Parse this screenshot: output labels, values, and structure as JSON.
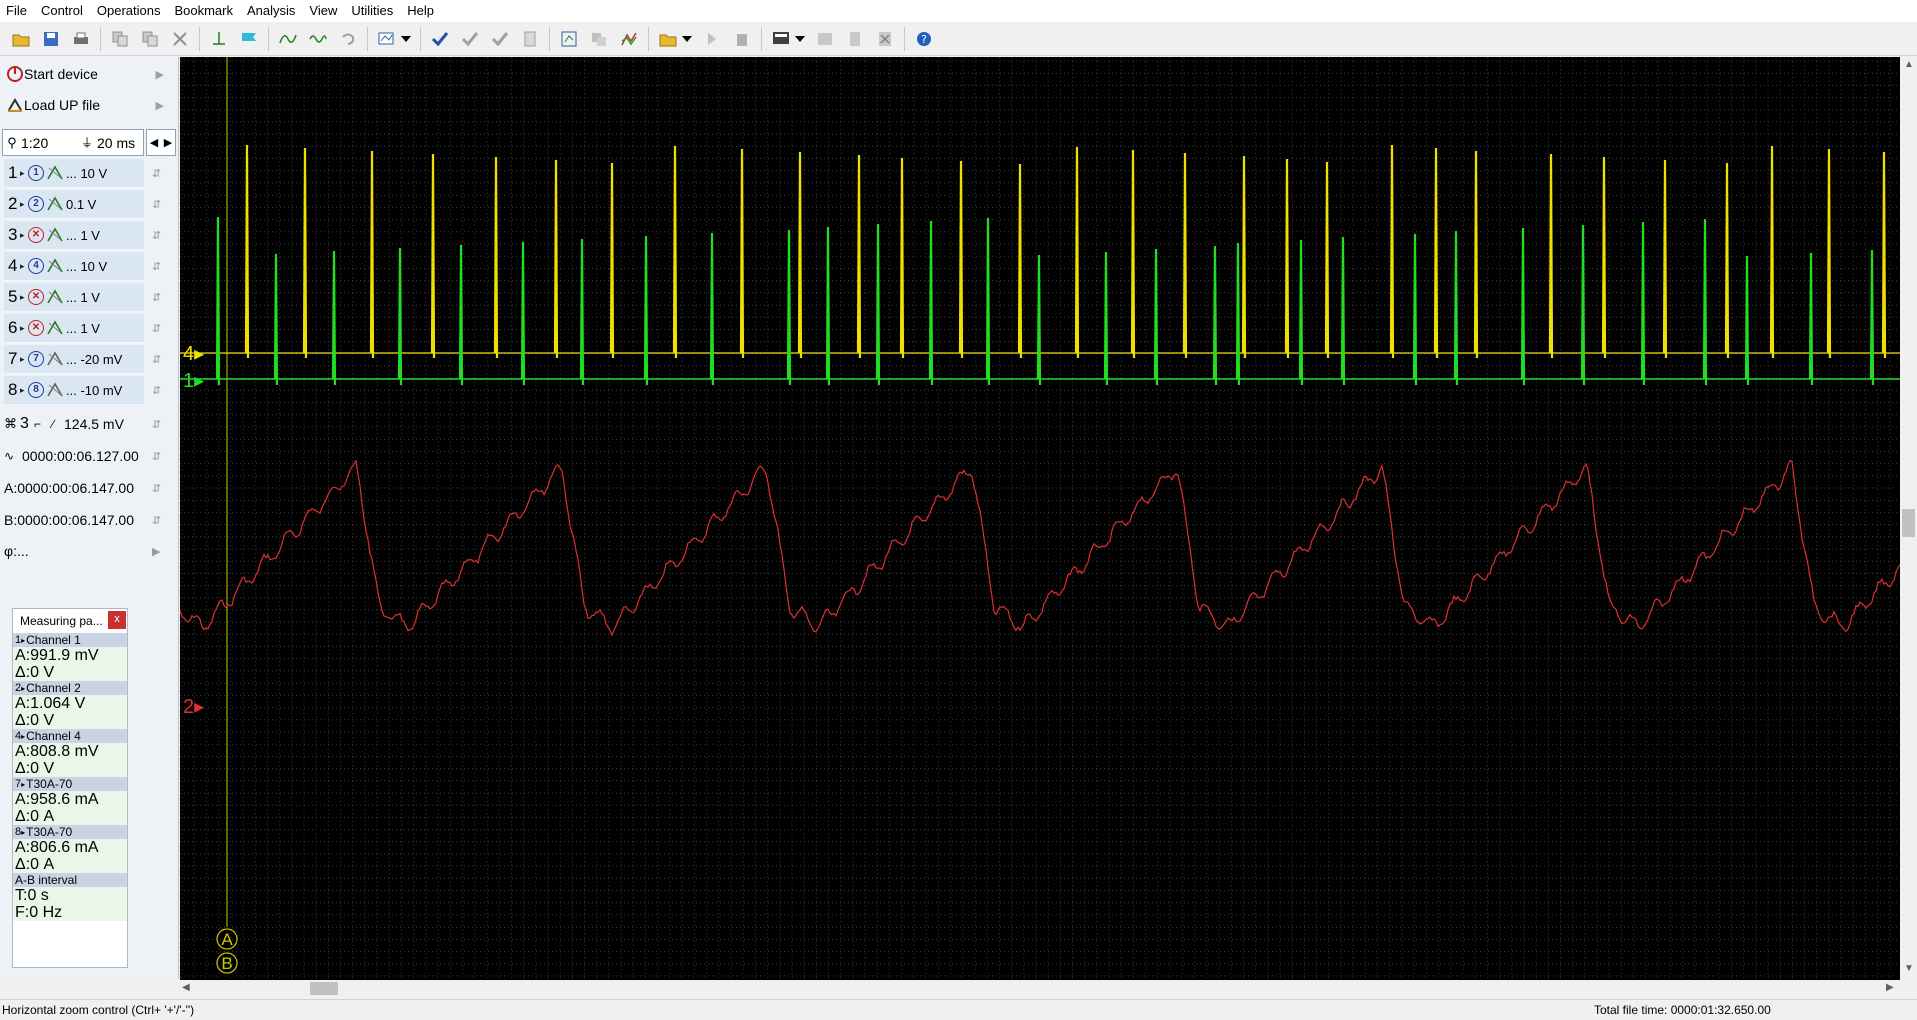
{
  "menu": [
    "File",
    "Control",
    "Operations",
    "Bookmark",
    "Analysis",
    "View",
    "Utilities",
    "Help"
  ],
  "left_panel": {
    "start_device": "Start device",
    "load_file": "Load UP file",
    "zoom_ratio": "1:20",
    "time_div": "20 ms",
    "channels": [
      {
        "num": "1",
        "probe": "1",
        "enabled": true,
        "coupling": "dc",
        "label": "... 10 V"
      },
      {
        "num": "2",
        "probe": "2",
        "enabled": true,
        "coupling": "dc",
        "label": "0.1 V"
      },
      {
        "num": "3",
        "probe": "3",
        "enabled": false,
        "coupling": "dc",
        "label": "... 1 V"
      },
      {
        "num": "4",
        "probe": "4",
        "enabled": true,
        "coupling": "dc",
        "label": "... 10 V"
      },
      {
        "num": "5",
        "probe": "5",
        "enabled": false,
        "coupling": "dc",
        "label": "... 1 V"
      },
      {
        "num": "6",
        "probe": "6",
        "enabled": false,
        "coupling": "dc",
        "label": "... 1 V"
      },
      {
        "num": "7",
        "probe": "7",
        "enabled": true,
        "coupling": "ac",
        "label": "... -20 mV"
      },
      {
        "num": "8",
        "probe": "8",
        "enabled": true,
        "coupling": "ac",
        "label": "... -10 mV"
      }
    ],
    "trigger": {
      "channel": "3",
      "level": "124.5 mV"
    },
    "trigger_time": "0000:00:06.127.00",
    "cursor_a": "A:0000:00:06.147.00",
    "cursor_b": "B:0000:00:06.147.00",
    "phase": "φ:..."
  },
  "measuring": {
    "title": "Measuring pa...",
    "sections": [
      {
        "header": "Channel 1",
        "hdr_num": "1",
        "a": "A:991.9 mV",
        "d": "Δ:0 V"
      },
      {
        "header": "Channel 2",
        "hdr_num": "2",
        "a": "A:1.064 V",
        "d": "Δ:0 V"
      },
      {
        "header": "Channel 4",
        "hdr_num": "4",
        "a": "A:808.8 mV",
        "d": "Δ:0 V"
      },
      {
        "header": "T30A-70",
        "hdr_num": "7",
        "a": "A:958.6 mA",
        "d": "Δ:0 A"
      },
      {
        "header": "T30A-70",
        "hdr_num": "8",
        "a": "A:806.6 mA",
        "d": "Δ:0 A"
      }
    ],
    "interval_header": "A-B interval",
    "interval_t": "T:0 s",
    "interval_f": "F:0 Hz"
  },
  "scope": {
    "markers": [
      "4",
      "1",
      "2",
      "A",
      "B"
    ],
    "colors": {
      "ch1": "#22dd22",
      "ch2": "#dd3030",
      "ch4": "#f0e000",
      "grid": "#3c3c3c",
      "cursor": "#c8c800"
    }
  },
  "status": {
    "hint": "Horizontal zoom control (Ctrl+ '+'/'-'')",
    "total": "Total file time: 0000:01:32.650.00"
  }
}
